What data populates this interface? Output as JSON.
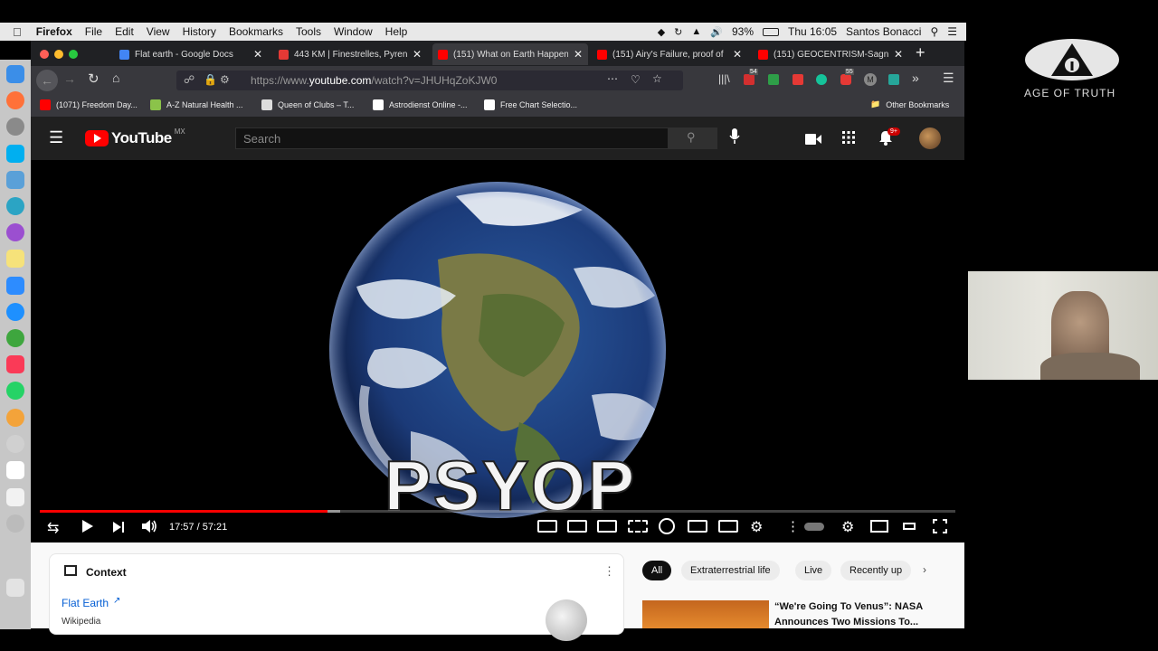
{
  "menubar": {
    "app": "Firefox",
    "items": [
      "File",
      "Edit",
      "View",
      "History",
      "Bookmarks",
      "Tools",
      "Window",
      "Help"
    ],
    "battery": "93%",
    "clock": "Thu 16:05",
    "user": "Santos Bonacci"
  },
  "tabs": [
    {
      "title": "Flat earth - Google Docs",
      "favicon_color": "#4285f4"
    },
    {
      "title": "443 KM | Finestrelles, Pyren",
      "favicon_color": "#e53935"
    },
    {
      "title": "(151) What on Earth Happen",
      "favicon_color": "#ff0000"
    },
    {
      "title": "(151) Airy's Failure, proof of",
      "favicon_color": "#ff0000"
    },
    {
      "title": "(151) GEOCENTRISM-Sagna",
      "favicon_color": "#ff0000"
    }
  ],
  "url": {
    "prefix": "https://www.",
    "domain": "youtube.com",
    "path": "/watch?v=JHUHqZoKJW0"
  },
  "bookmarks": [
    {
      "label": "(1071) Freedom Day...",
      "color": "#ff0000"
    },
    {
      "label": "A-Z Natural Health ...",
      "color": "#8bc34a"
    },
    {
      "label": "Queen of Clubs – T...",
      "color": "#dddddd"
    },
    {
      "label": "Astrodienst Online -...",
      "color": "#ffffff"
    },
    {
      "label": "Free Chart Selectio...",
      "color": "#ffffff"
    }
  ],
  "other_bookmarks": "Other Bookmarks",
  "badges": {
    "addon1": "54",
    "addon2": "55"
  },
  "youtube": {
    "logo_text": "YouTube",
    "region": "MX",
    "search_placeholder": "Search",
    "notifications": "9+"
  },
  "video": {
    "overlay_text": "PSYOP",
    "time": "17:57 / 57:21",
    "progress": 0.314,
    "buffered": 0.328
  },
  "context": {
    "heading": "Context",
    "link": "Flat Earth",
    "source": "Wikipedia"
  },
  "chips": [
    "All",
    "Extraterrestrial life",
    "Live",
    "Recently up"
  ],
  "recommended": {
    "title_line1": "“We're Going To Venus”: NASA",
    "title_line2": "Announces Two Missions To..."
  },
  "brand": {
    "name": "AGE OF TRUTH"
  },
  "colors": {
    "youtube_red": "#ff0000",
    "progress_red": "#ff0000",
    "link_blue": "#065fd4"
  }
}
